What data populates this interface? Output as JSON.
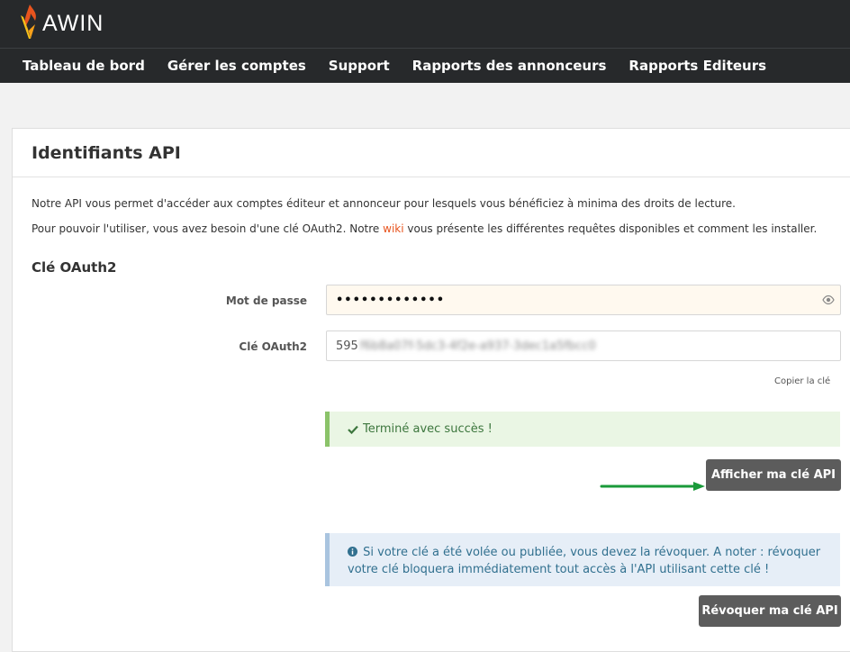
{
  "brand": {
    "name": "AWIN"
  },
  "nav": {
    "items": [
      {
        "label": "Tableau de bord"
      },
      {
        "label": "Gérer les comptes"
      },
      {
        "label": "Support"
      },
      {
        "label": "Rapports des annonceurs"
      },
      {
        "label": "Rapports Editeurs"
      }
    ]
  },
  "panel": {
    "title": "Identifiants API",
    "intro1": "Notre API vous permet d'accéder aux comptes éditeur et annonceur pour lesquels vous bénéficiez à minima des droits de lecture.",
    "intro2_before": "Pour pouvoir l'utiliser, vous avez besoin d'une clé OAuth2. Notre ",
    "intro2_link": "wiki",
    "intro2_after": " vous présente les différentes requêtes disponibles et comment les installer.",
    "section_title": "Clé OAuth2"
  },
  "form": {
    "password_label": "Mot de passe",
    "password_value": "•••••••••••••",
    "key_label": "Clé OAuth2",
    "key_prefix": "595",
    "key_blurred": "f6b8a07f-5dc3-4f2e-a937-3dec1a5fbcc0",
    "copy_label": "Copier la clé"
  },
  "alerts": {
    "success": "Terminé avec succès !",
    "info": "Si votre clé a été volée ou publiée, vous devez la révoquer. A noter : révoquer votre clé bloquera immédiatement tout accès à l'API utilisant cette clé !"
  },
  "buttons": {
    "show_key": "Afficher ma clé API",
    "revoke_key": "Révoquer ma clé API"
  },
  "colors": {
    "topbar": "#27292b",
    "accent": "#e8541e",
    "button": "#5c5c5c",
    "arrow": "#1a9a3a"
  }
}
